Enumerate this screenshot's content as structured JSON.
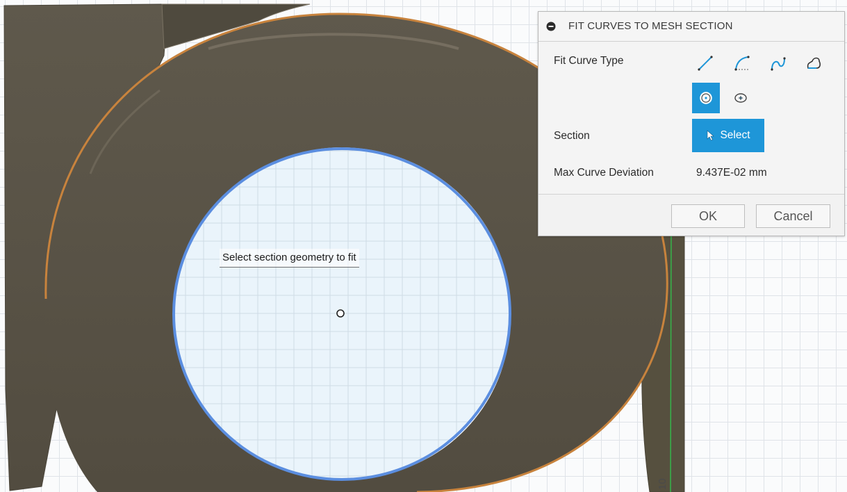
{
  "hint": {
    "text": "Select section geometry to fit"
  },
  "panel": {
    "title": "FIT CURVES TO MESH SECTION",
    "fit_curve_type_label": "Fit Curve Type",
    "fit_curve_types": [
      {
        "name": "line",
        "icon": "line-icon",
        "active": false
      },
      {
        "name": "arc",
        "icon": "arc-icon",
        "active": false
      },
      {
        "name": "spline",
        "icon": "spline-icon",
        "active": false
      },
      {
        "name": "closed-spline",
        "icon": "closed-spline-icon",
        "active": false
      },
      {
        "name": "circle",
        "icon": "circle-center-icon",
        "active": true
      },
      {
        "name": "ellipse",
        "icon": "ellipse-center-icon",
        "active": false
      }
    ],
    "section_label": "Section",
    "select_label": "Select",
    "max_deviation_label": "Max Curve Deviation",
    "max_deviation_value": "9.437E-02 mm",
    "ok_label": "OK",
    "cancel_label": "Cancel"
  },
  "viewport_marks": {
    "corner_digit": "10"
  },
  "colors": {
    "accent": "#1e96d8",
    "mesh_body": "#5c5648",
    "mesh_edge": "#c8833d",
    "section_edge": "#5b8ee0",
    "section_fill": "#eaf4fb",
    "axis_green": "#35b54a"
  }
}
